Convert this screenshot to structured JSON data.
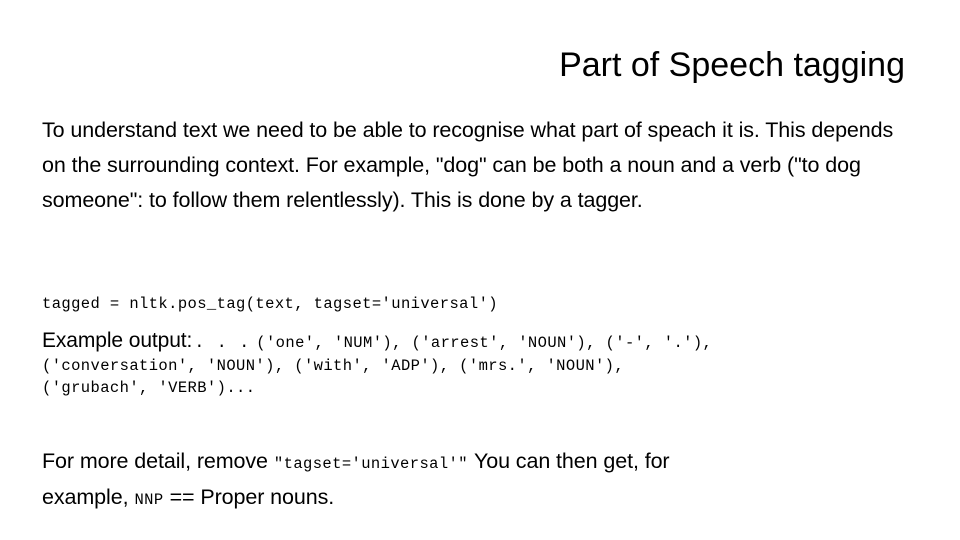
{
  "slide": {
    "title": "Part of Speech tagging",
    "intro_paragraph": "To understand text we need to be able to recognise what part of speach it is. This depends on the surrounding context. For example, \"dog\" can be both a noun and a verb (\"to dog someone\": to follow them relentlessly). This is done by a tagger.",
    "code_line": "tagged = nltk.pos_tag(text, tagset='universal')",
    "example": {
      "label": "Example output:",
      "ellipsis": ". . .",
      "output_lines": [
        "('one', 'NUM'), ('arrest', 'NOUN'), ('-', '.'),",
        "('conversation', 'NOUN'), ('with', 'ADP'), ('mrs.', 'NOUN'),",
        "('grubach', 'VERB')..."
      ]
    },
    "closing": {
      "line1_prefix": "For more detail, remove",
      "line1_code": "\"tagset='universal'\"",
      "line1_suffix": "You can then get, for",
      "line2_prefix": "example,",
      "line2_code": "NNP",
      "line2_suffix": "== Proper nouns."
    }
  }
}
